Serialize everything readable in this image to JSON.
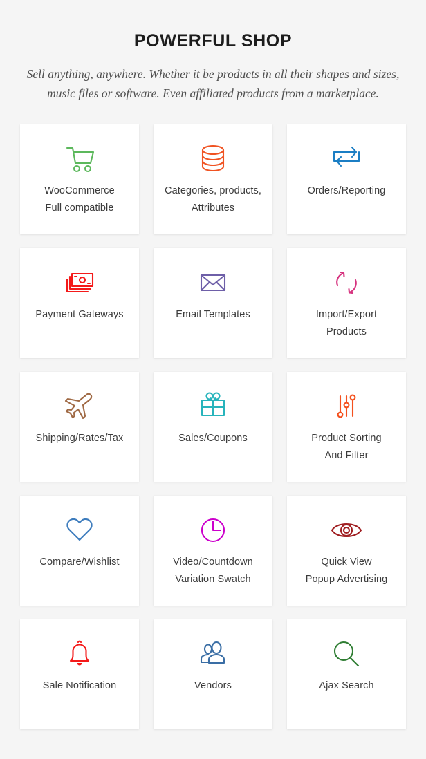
{
  "header": {
    "title": "POWERFUL SHOP",
    "subtitle": "Sell anything, anywhere. Whether it be products in all their shapes and sizes, music files or software. Even affiliated products from a marketplace."
  },
  "theme": {
    "page_background": "#f5f5f5",
    "card_background": "#ffffff",
    "title_color": "#1c1c1c",
    "subtitle_color": "#4f4f4f",
    "label_color": "#3c3c3c"
  },
  "features": [
    {
      "icon": "shopping-cart-icon",
      "color": "#5cb85c",
      "label": "WooCommerce Full compatible",
      "line1": "WooCommerce",
      "line2": "Full compatible"
    },
    {
      "icon": "database-icon",
      "color": "#f05322",
      "label": "Categories, products, Attributes",
      "line1": "Categories, products,",
      "line2": "Attributes"
    },
    {
      "icon": "exchange-arrows-icon",
      "color": "#1b7ec4",
      "label": "Orders/Reporting",
      "line1": "Orders/Reporting",
      "line2": ""
    },
    {
      "icon": "banknotes-icon",
      "color": "#f41a1a",
      "label": "Payment Gateways",
      "line1": "Payment Gateways",
      "line2": ""
    },
    {
      "icon": "envelope-icon",
      "color": "#6e5fa8",
      "label": "Email Templates",
      "line1": "Email Templates",
      "line2": ""
    },
    {
      "icon": "sync-arrows-icon",
      "color": "#d6337f",
      "label": "Import/Export Products",
      "line1": "Import/Export",
      "line2": "Products"
    },
    {
      "icon": "airplane-icon",
      "color": "#a06a45",
      "label": "Shipping/Rates/Tax",
      "line1": "Shipping/Rates/Tax",
      "line2": ""
    },
    {
      "icon": "gift-box-icon",
      "color": "#27b4bc",
      "label": "Sales/Coupons",
      "line1": "Sales/Coupons",
      "line2": ""
    },
    {
      "icon": "sliders-filter-icon",
      "color": "#f4511e",
      "label": "Product Sorting And Filter",
      "line1": "Product Sorting",
      "line2": "And Filter"
    },
    {
      "icon": "heart-icon",
      "color": "#3d7cbd",
      "label": "Compare/Wishlist",
      "line1": "Compare/Wishlist",
      "line2": ""
    },
    {
      "icon": "clock-icon",
      "color": "#cc00cc",
      "label": "Video/Countdown Variation Swatch",
      "line1": "Video/Countdown",
      "line2": "Variation Swatch"
    },
    {
      "icon": "eye-icon",
      "color": "#a01f22",
      "label": "Quick View Popup Advertising",
      "line1": "Quick View",
      "line2": "Popup Advertising"
    },
    {
      "icon": "bell-icon",
      "color": "#f41a1a",
      "label": "Sale Notification",
      "line1": "Sale Notification",
      "line2": ""
    },
    {
      "icon": "users-group-icon",
      "color": "#3a6ea5",
      "label": "Vendors",
      "line1": "Vendors",
      "line2": ""
    },
    {
      "icon": "magnifier-search-icon",
      "color": "#2e7d32",
      "label": "Ajax Search",
      "line1": "Ajax Search",
      "line2": ""
    }
  ]
}
